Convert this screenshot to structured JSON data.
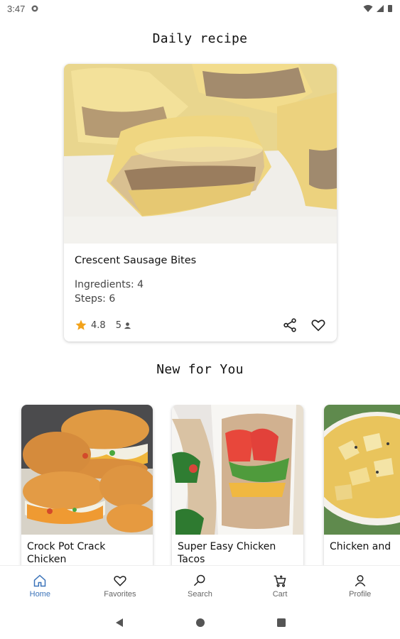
{
  "status": {
    "time": "3:47"
  },
  "daily": {
    "section_title": "Daily recipe",
    "name": "Crescent Sausage Bites",
    "ingredients": "Ingredients: 4",
    "steps": "Steps: 6",
    "rating": "4.8",
    "people": "5"
  },
  "new_for_you": {
    "section_title": "New for You",
    "items": [
      {
        "name": "Crock Pot Crack Chicken"
      },
      {
        "name": "Super Easy Chicken Tacos"
      },
      {
        "name": "Chicken and"
      }
    ]
  },
  "nav": {
    "items": [
      {
        "label": "Home",
        "icon": "home-icon",
        "active": true
      },
      {
        "label": "Favorites",
        "icon": "heart-icon"
      },
      {
        "label": "Search",
        "icon": "search-icon"
      },
      {
        "label": "Cart",
        "icon": "cart-icon"
      },
      {
        "label": "Profile",
        "icon": "person-icon"
      }
    ]
  },
  "colors": {
    "accent": "#3b73b9",
    "star": "#f2a21a"
  }
}
